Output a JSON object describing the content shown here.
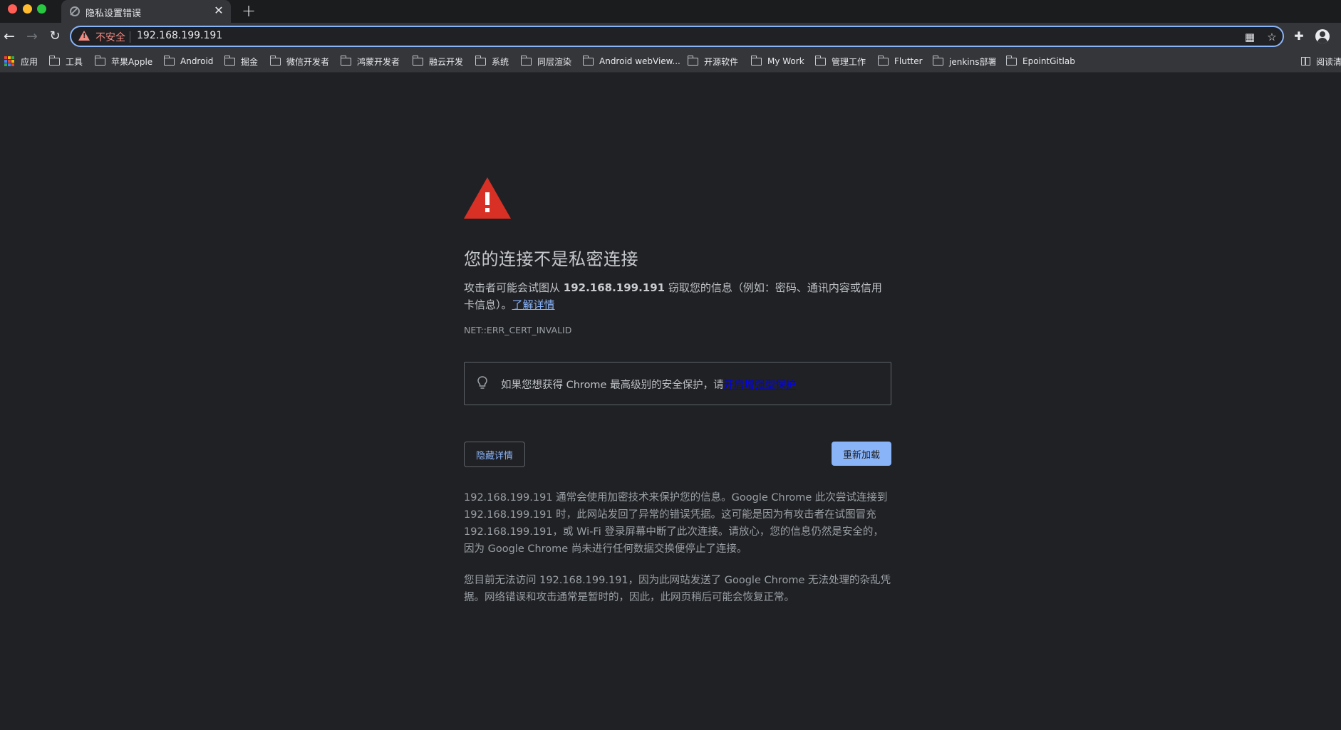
{
  "window": {
    "tab_title": "隐私设置错误",
    "tab_close": "✕",
    "new_tab": "+"
  },
  "toolbar": {
    "back": "←",
    "forward": "→",
    "reload": "↻",
    "security_label": "不安全",
    "url": "192.168.199.191",
    "qr_icon": "qr-code-icon",
    "star_icon": "bookmark-star-icon",
    "extensions_icon": "puzzle-icon",
    "profile_icon": "profile-icon"
  },
  "bookmarks": {
    "apps_label": "应用",
    "items": [
      "工具",
      "苹果Apple",
      "Android",
      "掘金",
      "微信开发者",
      "鸿蒙开发者",
      "融云开发",
      "系统",
      "同层渲染",
      "Android webView...",
      "开源软件",
      "My Work",
      "管理工作",
      "Flutter",
      "jenkins部署",
      "EpointGitlab"
    ],
    "reading_list_label": "阅读清"
  },
  "interstitial": {
    "heading": "您的连接不是私密连接",
    "desc_prefix": "攻击者可能会试图从 ",
    "desc_host": "192.168.199.191",
    "desc_suffix": " 窃取您的信息（例如：密码、通讯内容或信用卡信息）。",
    "learn_more": "了解详情",
    "error_code": "NET::ERR_CERT_INVALID",
    "enhanced_prefix": "如果您想获得 Chrome 最高级别的安全保护，请",
    "enhanced_link": "开启增强型保护",
    "hide_details_button": "隐藏详情",
    "reload_button": "重新加载",
    "details_p1": "192.168.199.191 通常会使用加密技术来保护您的信息。Google Chrome 此次尝试连接到 192.168.199.191 时，此网站发回了异常的错误凭据。这可能是因为有攻击者在试图冒充 192.168.199.191，或 Wi-Fi 登录屏幕中断了此次连接。请放心，您的信息仍然是安全的，因为 Google Chrome 尚未进行任何数据交换便停止了连接。",
    "details_p2": "您目前无法访问 192.168.199.191，因为此网站发送了 Google Chrome 无法处理的杂乱凭据。网络错误和攻击通常是暂时的，因此，此网页稍后可能会恢复正常。"
  },
  "colors": {
    "page_bg": "#202124",
    "toolbar_bg": "#35363a",
    "accent_blue": "#8ab4f8",
    "warning_red": "#f28b82",
    "big_warning_red": "#d93025"
  }
}
